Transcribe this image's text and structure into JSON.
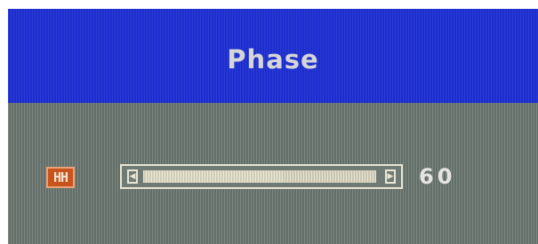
{
  "osd": {
    "title": "Phase",
    "control_icon": {
      "name": "phase-control-icon",
      "label": "HH"
    },
    "slider": {
      "value": 60,
      "max": 100,
      "left_arrow": "left-arrow-icon",
      "right_arrow": "right-arrow-icon"
    },
    "value_text": "60"
  },
  "colors": {
    "header_blue": "#1d2ecf",
    "body_gray": "#6f7b74",
    "icon_orange": "#c9531c",
    "slider_fill": "#e1ddc6",
    "text_light": "#e4e4e4"
  }
}
